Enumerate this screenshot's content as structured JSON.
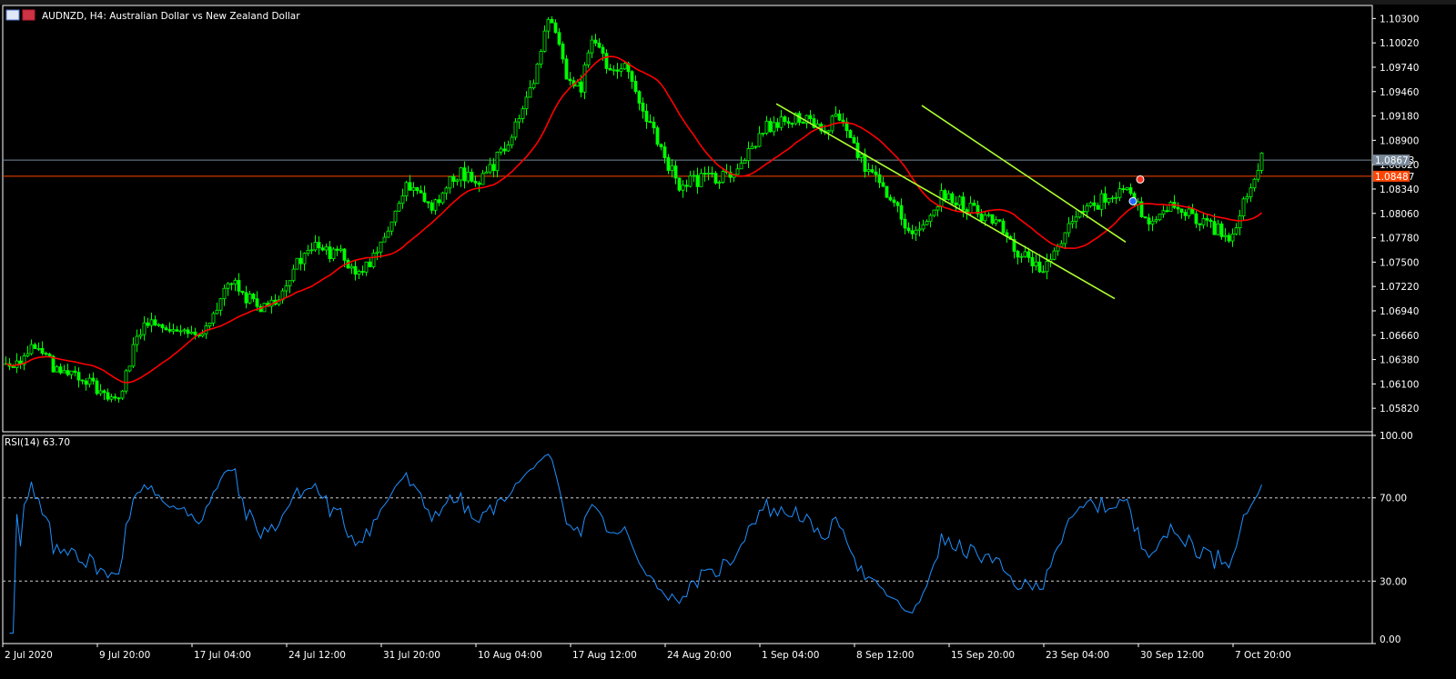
{
  "chart_data": {
    "type": "candlestick",
    "title": "AUDNZD, H4:  Australian Dollar vs New Zealand Dollar",
    "colors": {
      "background": "#000000",
      "candle": "#00ff00",
      "ma": "#ff0000",
      "trend": "#adff2f",
      "rsi": "#1e90ff",
      "bid_line": "#778899",
      "ask_line": "#ff4500"
    },
    "ylim": [
      1.0555,
      1.1045
    ],
    "y_ticks": [
      "1.10300",
      "1.10020",
      "1.09740",
      "1.09460",
      "1.09180",
      "1.08900",
      "1.08620",
      "1.08340",
      "1.08060",
      "1.07780",
      "1.07500",
      "1.07220",
      "1.06940",
      "1.06660",
      "1.06380",
      "1.06100",
      "1.05820"
    ],
    "x_ticks": [
      "2 Jul 2020",
      "9 Jul 20:00",
      "17 Jul 04:00",
      "24 Jul 12:00",
      "31 Jul 20:00",
      "10 Aug 04:00",
      "17 Aug 12:00",
      "24 Aug 20:00",
      "1 Sep 04:00",
      "8 Sep 12:00",
      "15 Sep 20:00",
      "23 Sep 04:00",
      "30 Sep 12:00",
      "7 Oct 20:00"
    ],
    "bars_total": 346,
    "price_path": [
      [
        0,
        1.0637
      ],
      [
        8,
        1.0632
      ],
      [
        14,
        1.065
      ],
      [
        20,
        1.0645
      ],
      [
        28,
        1.0622
      ],
      [
        36,
        1.0628
      ],
      [
        44,
        1.0612
      ],
      [
        50,
        1.0606
      ],
      [
        56,
        1.0589
      ],
      [
        62,
        1.06
      ],
      [
        68,
        1.0642
      ],
      [
        74,
        1.0678
      ],
      [
        80,
        1.0685
      ],
      [
        88,
        1.0666
      ],
      [
        96,
        1.0675
      ],
      [
        104,
        1.0668
      ],
      [
        110,
        1.0678
      ],
      [
        116,
        1.0698
      ],
      [
        120,
        1.073
      ],
      [
        128,
        1.0715
      ],
      [
        136,
        1.07
      ],
      [
        144,
        1.07
      ],
      [
        152,
        1.0722
      ],
      [
        160,
        1.0755
      ],
      [
        168,
        1.077
      ],
      [
        176,
        1.076
      ],
      [
        182,
        1.0758
      ],
      [
        190,
        1.074
      ],
      [
        198,
        1.0752
      ],
      [
        206,
        1.0778
      ],
      [
        212,
        1.0812
      ],
      [
        218,
        1.0838
      ],
      [
        224,
        1.0825
      ],
      [
        232,
        1.0815
      ],
      [
        240,
        1.084
      ],
      [
        248,
        1.0852
      ],
      [
        256,
        1.0838
      ],
      [
        264,
        1.086
      ],
      [
        270,
        1.088
      ],
      [
        278,
        1.0912
      ],
      [
        284,
        1.0942
      ],
      [
        290,
        1.099
      ],
      [
        295,
        1.1025
      ],
      [
        300,
        1.1
      ],
      [
        305,
        1.0955
      ],
      [
        312,
        1.095
      ],
      [
        318,
        1.101
      ],
      [
        324,
        1.0985
      ],
      [
        330,
        1.0965
      ],
      [
        336,
        1.0975
      ]
    ],
    "sample_note": "",
    "ma_period": 21,
    "horizontal_lines": [
      {
        "name": "bid",
        "price": 1.08673,
        "label": "1.08673"
      },
      {
        "name": "ask",
        "price": 1.08487,
        "label": "1.08487"
      }
    ],
    "trendlines": [
      {
        "from": [
          "24 Aug",
          1.0932
        ],
        "to": [
          "25 Sep",
          1.0708
        ]
      },
      {
        "from": [
          "10 Sep",
          1.093
        ],
        "to": [
          "26 Sep",
          1.0773
        ]
      }
    ],
    "rsi": {
      "label": "RSI(14) 63.70",
      "value": 63.7,
      "levels": [
        70,
        30
      ],
      "ylim": [
        0,
        100
      ],
      "ticks": [
        "100.00",
        "70.00",
        "30.00",
        "0.00"
      ]
    }
  }
}
